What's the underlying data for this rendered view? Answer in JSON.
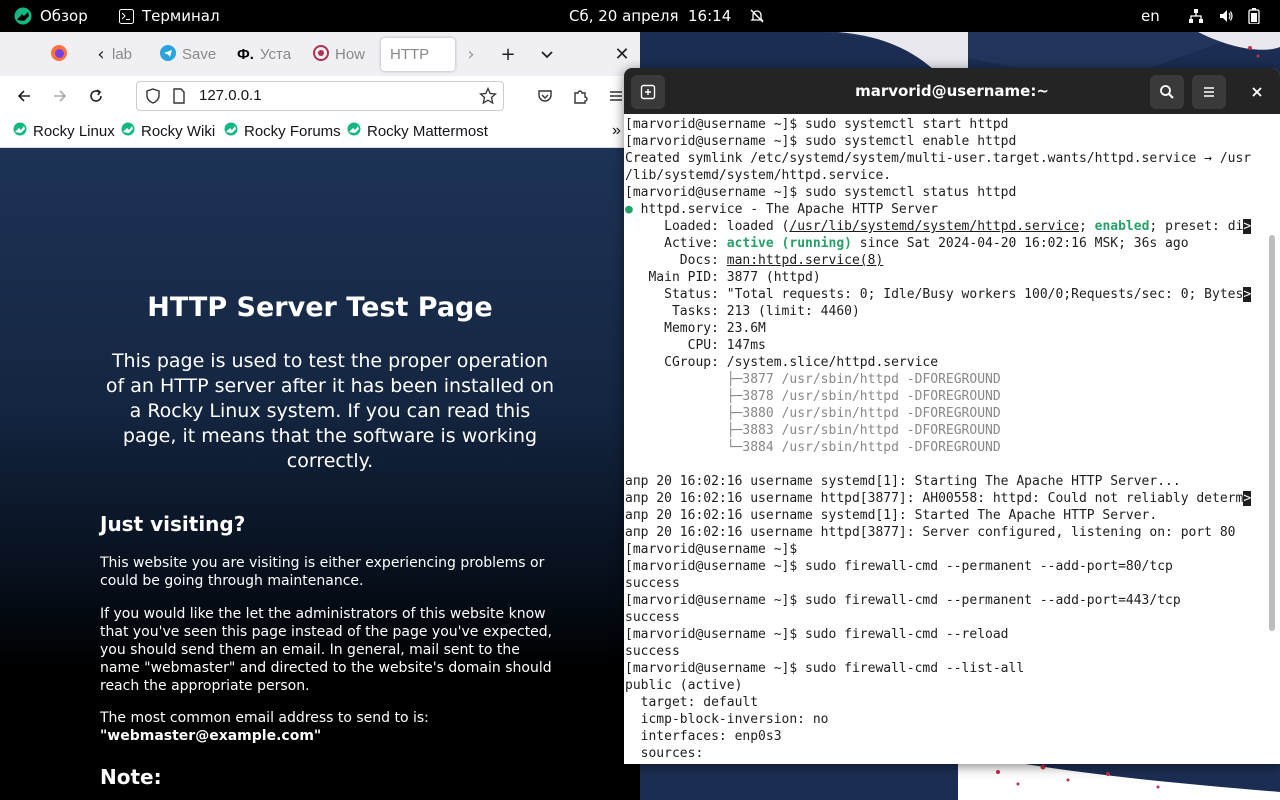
{
  "topbar": {
    "overview": "Обзор",
    "terminal_app": "Терминал",
    "datetime": "Сб, 20 апреля  16:14",
    "lang": "en"
  },
  "firefox": {
    "tabs": [
      "lab",
      "Save",
      "Уста",
      "How",
      "HTTP"
    ],
    "url": "127.0.0.1",
    "bookmarks": [
      "Rocky Linux",
      "Rocky Wiki",
      "Rocky Forums",
      "Rocky Mattermost"
    ],
    "page": {
      "title": "HTTP Server Test Page",
      "lead": "This page is used to test the proper operation of an HTTP server after it has been installed on a Rocky Linux system. If you can read this page, it means that the software is working correctly.",
      "h2": "Just visiting?",
      "p1": "This website you are visiting is either experiencing problems or could be going through maintenance.",
      "p2": "If you would like the let the administrators of this website know that you've seen this page instead of the page you've expected, you should send them an email. In general, mail sent to the name \"webmaster\" and directed to the website's domain should reach the appropriate person.",
      "p3": "The most common email address to send to is:",
      "email": "\"webmaster@example.com\"",
      "h3": "Note:"
    }
  },
  "terminal": {
    "title": "marvorid@username:~",
    "l1": "[marvorid@username ~]$ sudo systemctl start httpd",
    "l2": "[marvorid@username ~]$ sudo systemctl enable httpd",
    "l3": "Created symlink /etc/systemd/system/multi-user.target.wants/httpd.service → /usr",
    "l4": "/lib/systemd/system/httpd.service.",
    "l5": "[marvorid@username ~]$ sudo systemctl status httpd",
    "l6_dot": "●",
    "l6": " httpd.service - The Apache HTTP Server",
    "l7_a": "     Loaded: loaded (",
    "l7_path": "/usr/lib/systemd/system/httpd.service",
    "l7_b": "; ",
    "l7_enabled": "enabled",
    "l7_c": "; preset: di",
    "l7_more": ">",
    "l8_a": "     Active: ",
    "l8_active": "active (running)",
    "l8_b": " since Sat 2024-04-20 16:02:16 MSK; 36s ago",
    "l9_a": "       Docs: ",
    "l9_link": "man:httpd.service(8)",
    "l10": "   Main PID: 3877 (httpd)",
    "l11": "     Status: \"Total requests: 0; Idle/Busy workers 100/0;Requests/sec: 0; Bytes",
    "l11_more": ">",
    "l12": "      Tasks: 213 (limit: 4460)",
    "l13": "     Memory: 23.6M",
    "l14": "        CPU: 147ms",
    "l15": "     CGroup: /system.slice/httpd.service",
    "cg_tree": [
      "             ├─",
      "             ├─",
      "             ├─",
      "             ├─",
      "             └─"
    ],
    "cg": [
      "3877 /usr/sbin/httpd -DFOREGROUND",
      "3878 /usr/sbin/httpd -DFOREGROUND",
      "3880 /usr/sbin/httpd -DFOREGROUND",
      "3883 /usr/sbin/httpd -DFOREGROUND",
      "3884 /usr/sbin/httpd -DFOREGROUND"
    ],
    "log1": "апр 20 16:02:16 username systemd[1]: Starting The Apache HTTP Server...",
    "log2": "апр 20 16:02:16 username httpd[3877]: AH00558: httpd: Could not reliably determ",
    "log2_more": ">",
    "log3": "апр 20 16:02:16 username systemd[1]: Started The Apache HTTP Server.",
    "log4": "апр 20 16:02:16 username httpd[3877]: Server configured, listening on: port 80",
    "p1": "[marvorid@username ~]$",
    "p2": "[marvorid@username ~]$ sudo firewall-cmd --permanent --add-port=80/tcp",
    "s1": "success",
    "p3": "[marvorid@username ~]$ sudo firewall-cmd --permanent --add-port=443/tcp",
    "s2": "success",
    "p4": "[marvorid@username ~]$ sudo firewall-cmd --reload",
    "s3": "success",
    "p5": "[marvorid@username ~]$ sudo firewall-cmd --list-all",
    "fw1": "public (active)",
    "fw2": "  target: default",
    "fw3": "  icmp-block-inversion: no",
    "fw4": "  interfaces: enp0s3",
    "fw5": "  sources:"
  },
  "colors": {
    "topbar": "#000000",
    "terminal_header": "#242424",
    "terminal_green": "#26a269",
    "page_bg": "#1d3356"
  }
}
